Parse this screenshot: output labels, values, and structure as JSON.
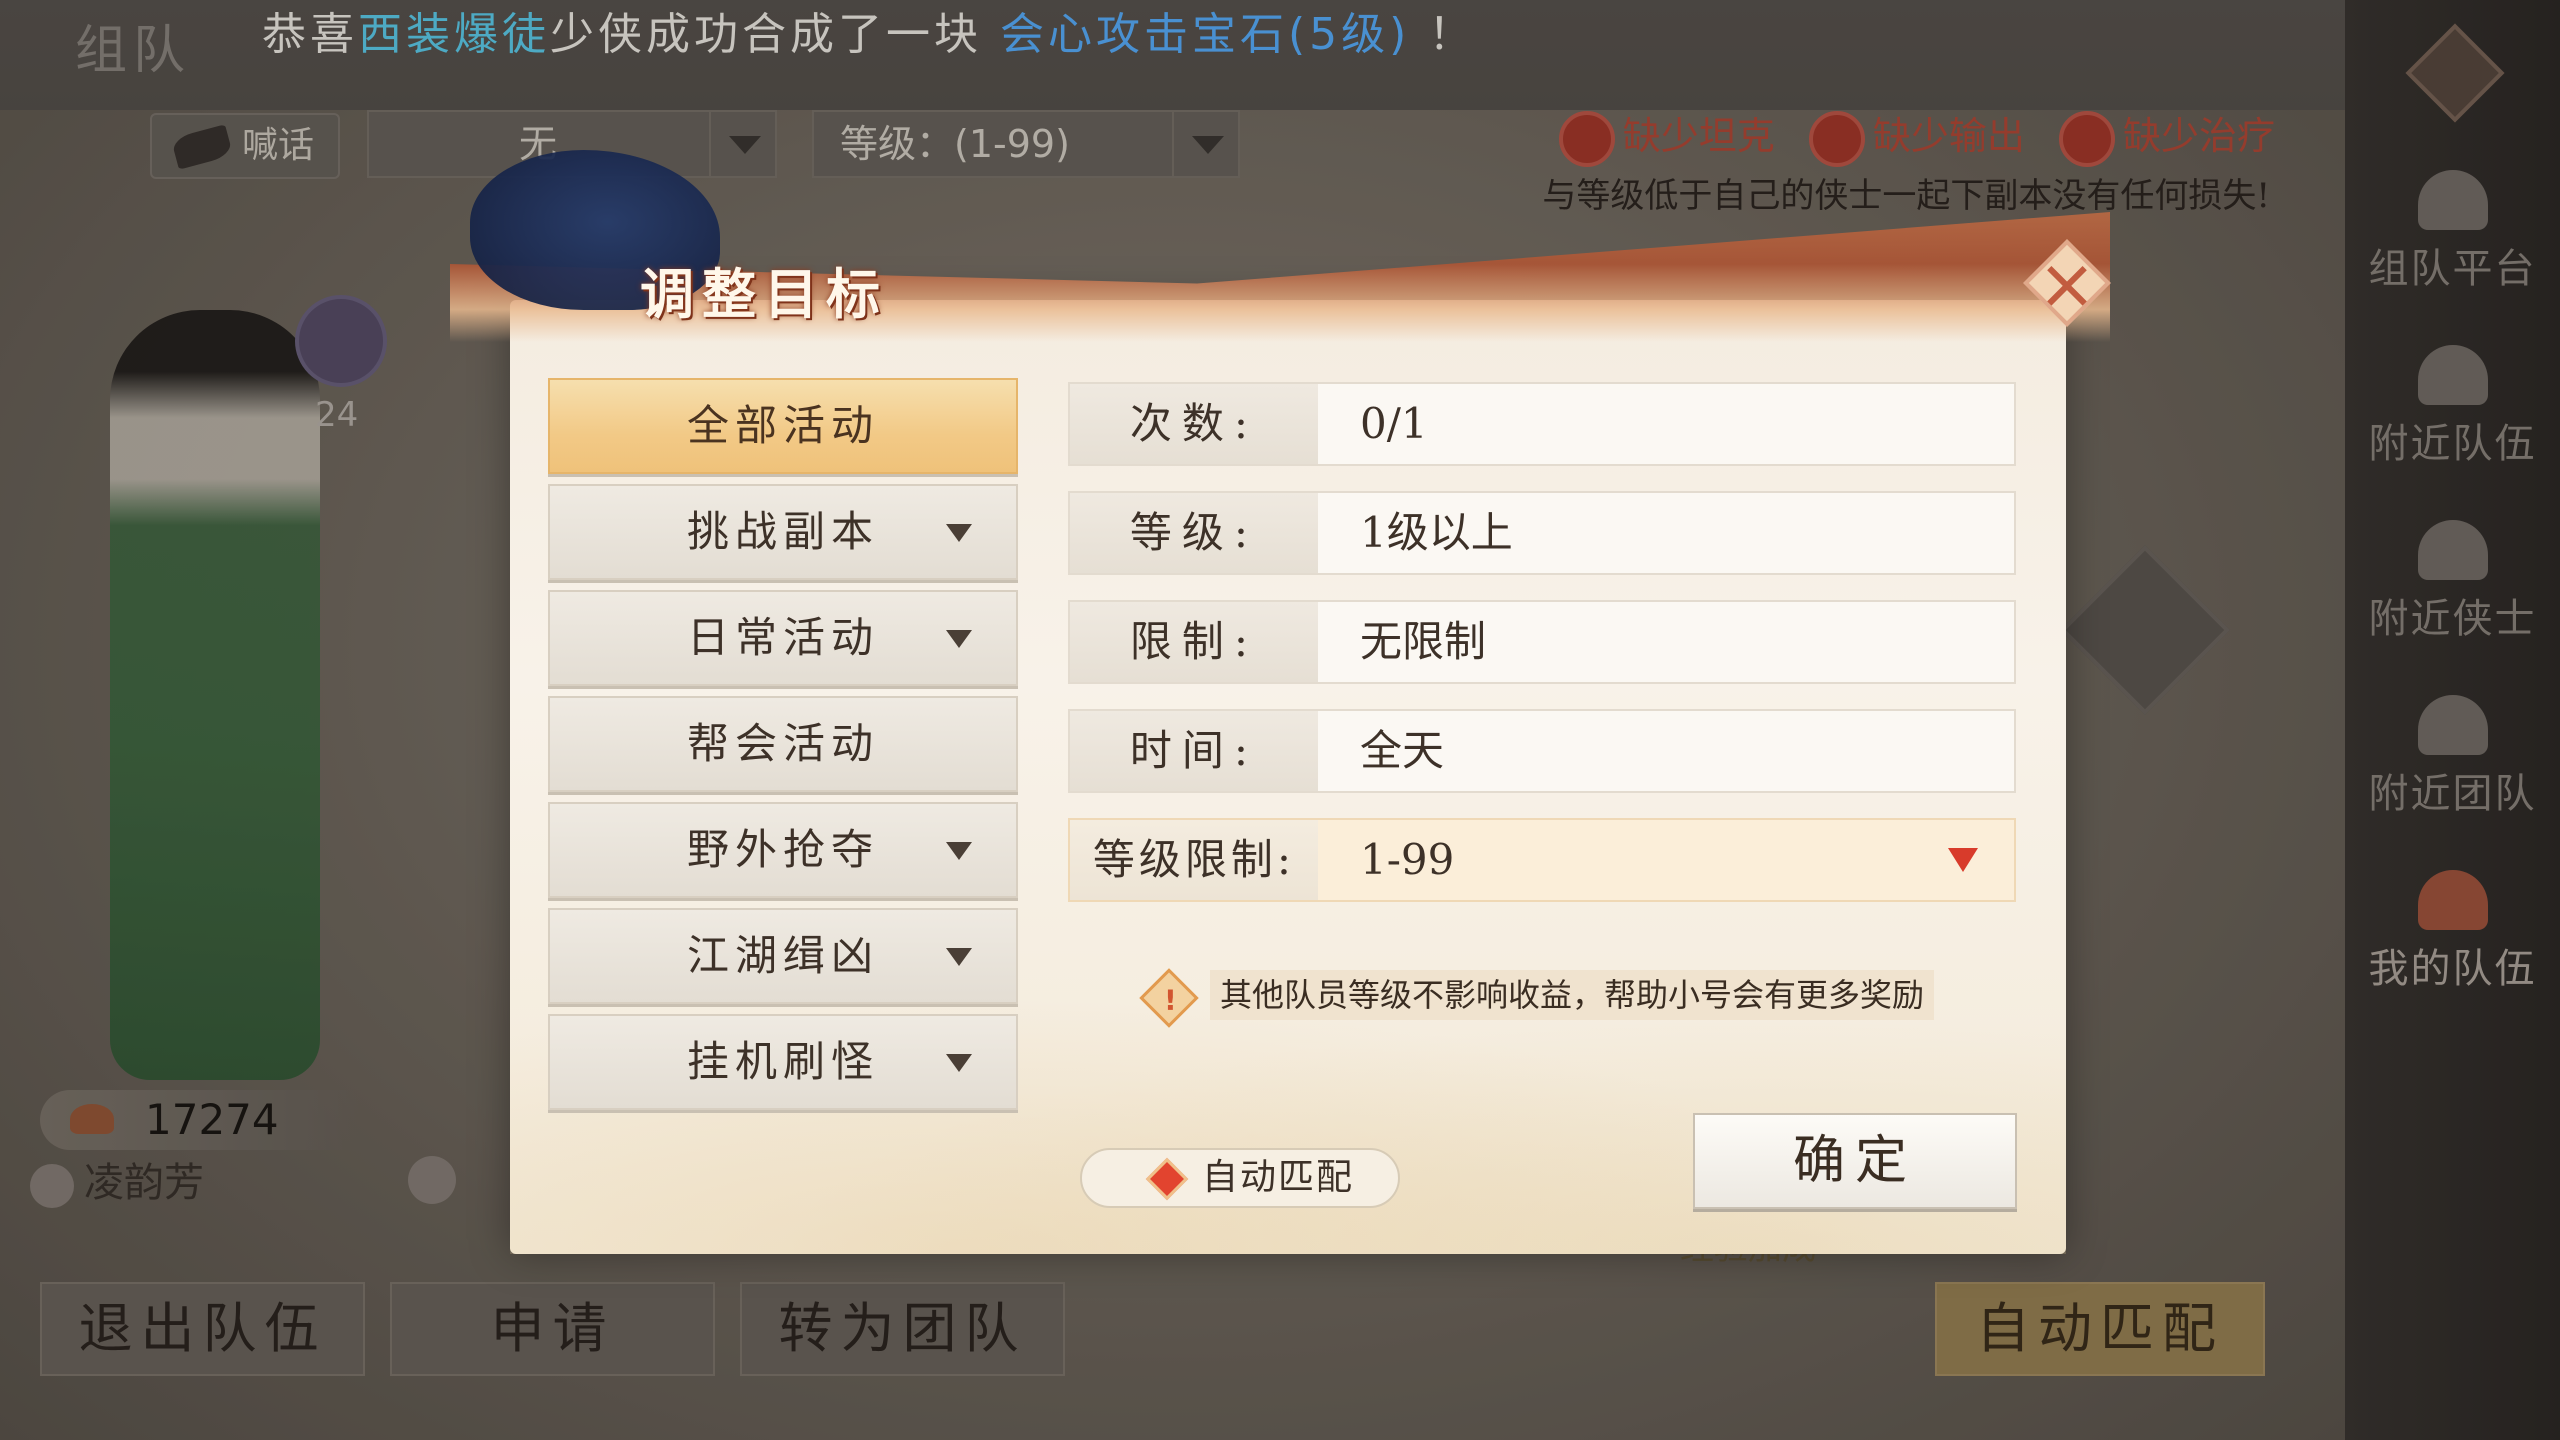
{
  "announcement": {
    "prefix": "恭喜",
    "player": "西装爆徒",
    "middle": "少侠成功合成了一块",
    "item": "会心攻击宝石(5级)",
    "suffix": "！"
  },
  "team_screen": {
    "title": "组队",
    "shout_label": "喊话",
    "target_select": "无",
    "level_select": "等级：(1-99)",
    "missing": [
      "缺少坦克",
      "缺少输出",
      "缺少治疗"
    ],
    "hint": "与等级低于自己的侠士一起下副本没有任何损失!",
    "character": {
      "level": "24",
      "power": "17274",
      "name": "凌韵芳"
    },
    "bottom_buttons": [
      "退出队伍",
      "申请",
      "转为团队"
    ],
    "auto_match_button": "自动匹配",
    "bottom_note": "经验加成"
  },
  "sidebar": {
    "items": [
      "组队平台",
      "附近队伍",
      "附近侠士",
      "附近团队",
      "我的队伍"
    ]
  },
  "modal": {
    "title": "调整目标",
    "tabs": [
      {
        "label": "全部活动",
        "dropdown": false,
        "active": true
      },
      {
        "label": "挑战副本",
        "dropdown": true,
        "active": false
      },
      {
        "label": "日常活动",
        "dropdown": true,
        "active": false
      },
      {
        "label": "帮会活动",
        "dropdown": false,
        "active": false
      },
      {
        "label": "野外抢夺",
        "dropdown": true,
        "active": false
      },
      {
        "label": "江湖缉凶",
        "dropdown": true,
        "active": false
      },
      {
        "label": "挂机刷怪",
        "dropdown": true,
        "active": false
      }
    ],
    "info": [
      {
        "label": "次数:",
        "value": "0/1"
      },
      {
        "label": "等级:",
        "value": "1级以上"
      },
      {
        "label": "限制:",
        "value": "无限制"
      },
      {
        "label": "时间:",
        "value": "全天"
      },
      {
        "label": "等级限制:",
        "value": "1-99"
      }
    ],
    "notice": "其他队员等级不影响收益，帮助小号会有更多奖励",
    "auto_match": "自动匹配",
    "confirm": "确定"
  },
  "colors": {
    "accent_gold": "#f2c986",
    "dropdown_red": "#d83b2b",
    "announce_name": "#5fd0f0",
    "announce_item": "#5ab0ff",
    "missing_red": "#b54a38"
  }
}
